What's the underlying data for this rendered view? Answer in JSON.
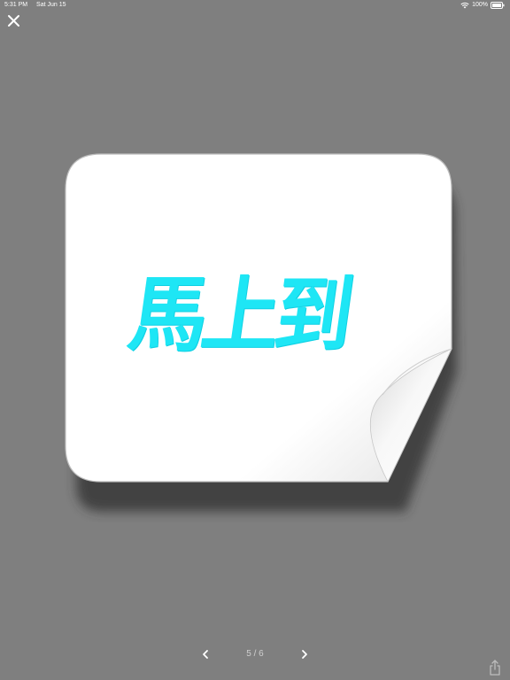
{
  "status_bar": {
    "time": "5:31 PM",
    "date": "Sat Jun 15",
    "battery_percent": "100%",
    "wifi_icon": "wifi-icon",
    "battery_icon": "battery-icon"
  },
  "toolbar": {
    "close_icon": "close-icon",
    "share_icon": "share-icon"
  },
  "sticker": {
    "text": "馬上到",
    "text_color": "#1ee6f5",
    "background_color": "#ffffff"
  },
  "pager": {
    "indicator": "5 / 6",
    "prev_icon": "chevron-left-icon",
    "next_icon": "chevron-right-icon"
  },
  "colors": {
    "background": "#7f7f7f"
  }
}
